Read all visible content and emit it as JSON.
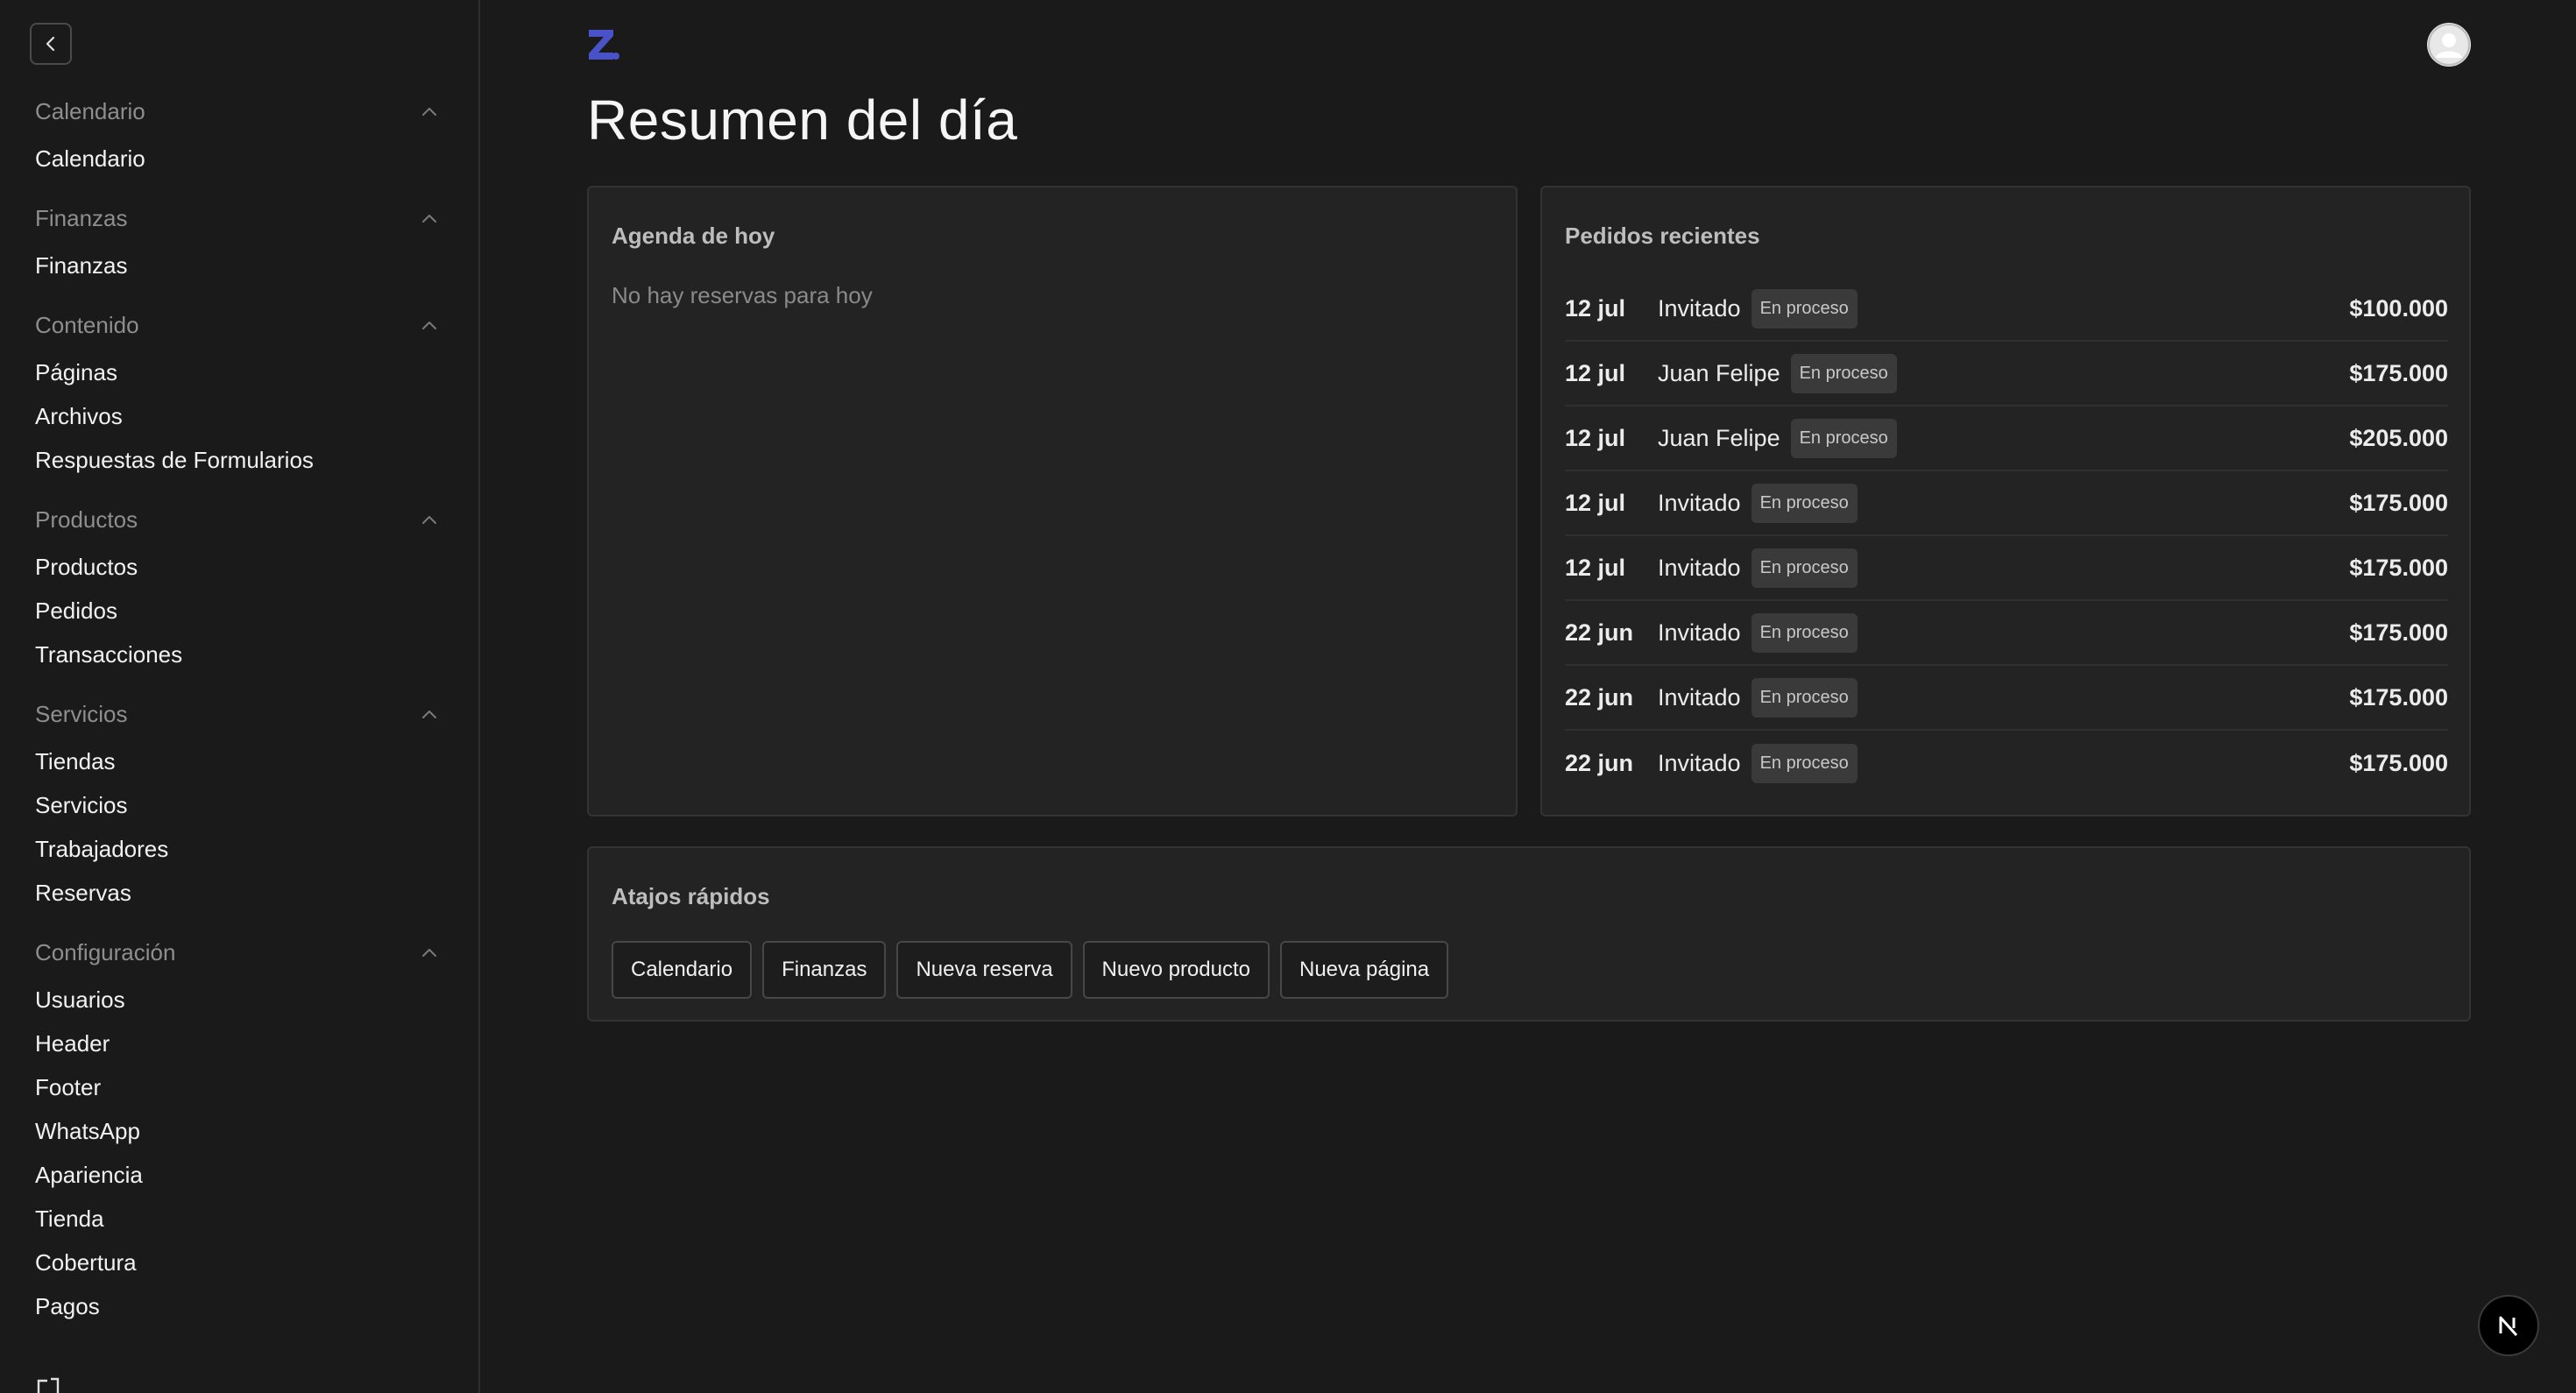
{
  "sidebar": {
    "sections": [
      {
        "title": "Calendario",
        "items": [
          "Calendario"
        ]
      },
      {
        "title": "Finanzas",
        "items": [
          "Finanzas"
        ]
      },
      {
        "title": "Contenido",
        "items": [
          "Páginas",
          "Archivos",
          "Respuestas de Formularios"
        ]
      },
      {
        "title": "Productos",
        "items": [
          "Productos",
          "Pedidos",
          "Transacciones"
        ]
      },
      {
        "title": "Servicios",
        "items": [
          "Tiendas",
          "Servicios",
          "Trabajadores",
          "Reservas"
        ]
      },
      {
        "title": "Configuración",
        "items": [
          "Usuarios",
          "Header",
          "Footer",
          "WhatsApp",
          "Apariencia",
          "Tienda",
          "Cobertura",
          "Pagos"
        ]
      }
    ]
  },
  "header": {
    "title": "Resumen del día"
  },
  "agenda": {
    "title": "Agenda de hoy",
    "empty": "No hay reservas para hoy"
  },
  "orders": {
    "title": "Pedidos recientes",
    "rows": [
      {
        "date": "12 jul",
        "name": "Invitado",
        "status": "En proceso",
        "amount": "$100.000"
      },
      {
        "date": "12 jul",
        "name": "Juan Felipe",
        "status": "En proceso",
        "amount": "$175.000"
      },
      {
        "date": "12 jul",
        "name": "Juan Felipe",
        "status": "En proceso",
        "amount": "$205.000"
      },
      {
        "date": "12 jul",
        "name": "Invitado",
        "status": "En proceso",
        "amount": "$175.000"
      },
      {
        "date": "12 jul",
        "name": "Invitado",
        "status": "En proceso",
        "amount": "$175.000"
      },
      {
        "date": "22 jun",
        "name": "Invitado",
        "status": "En proceso",
        "amount": "$175.000"
      },
      {
        "date": "22 jun",
        "name": "Invitado",
        "status": "En proceso",
        "amount": "$175.000"
      },
      {
        "date": "22 jun",
        "name": "Invitado",
        "status": "En proceso",
        "amount": "$175.000"
      }
    ]
  },
  "shortcuts": {
    "title": "Atajos rápidos",
    "buttons": [
      "Calendario",
      "Finanzas",
      "Nueva reserva",
      "Nuevo producto",
      "Nueva página"
    ]
  },
  "icons": {
    "collapse": "chevron-left-icon",
    "section_toggle": "chevron-up-icon",
    "logo": "z-logo",
    "avatar": "user-avatar-icon",
    "logout": "logout-icon",
    "dev_badge": "nextjs-n-icon"
  },
  "colors": {
    "background": "#1a1a1a",
    "card": "#232323",
    "brand": "#4a52c8",
    "badge": "#3a3a3a"
  }
}
